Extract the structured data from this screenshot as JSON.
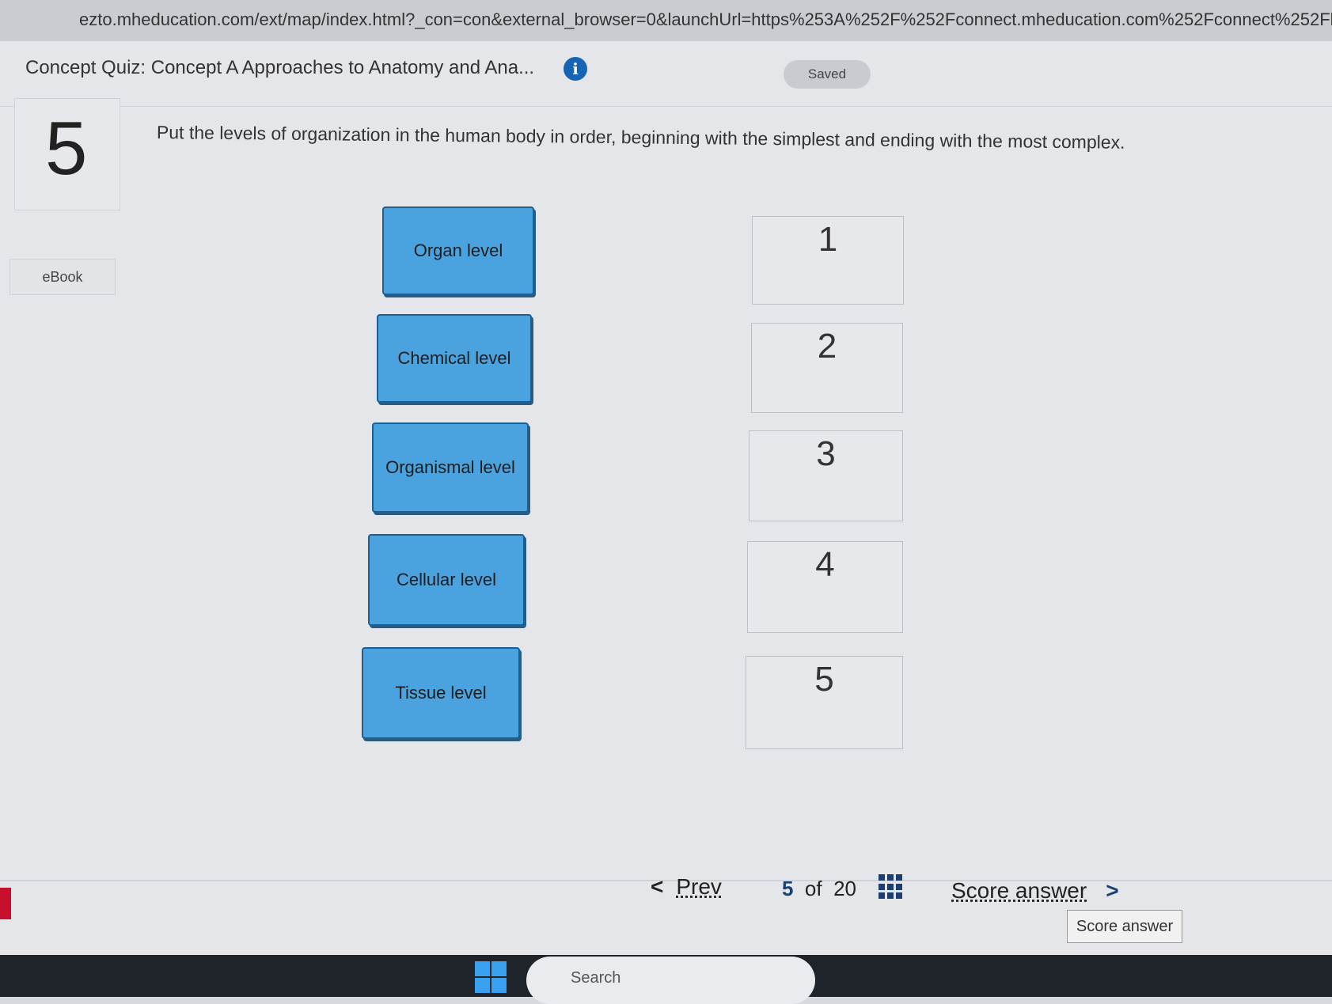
{
  "browser": {
    "url": "ezto.mheducation.com/ext/map/index.html?_con=con&external_browser=0&launchUrl=https%253A%252F%252Fconnect.mheducation.com%252Fconnect%252Fl"
  },
  "header": {
    "quiz_title": "Concept Quiz: Concept A Approaches to Anatomy and Ana...",
    "save_status": "Saved"
  },
  "question": {
    "number": "5",
    "prompt": "Put the levels of organization in the human body in order, beginning with the simplest and ending with the most complex."
  },
  "sidebar": {
    "ebook_label": "eBook"
  },
  "drag_items": [
    {
      "label": "Organ level"
    },
    {
      "label": "Chemical level"
    },
    {
      "label": "Organismal level"
    },
    {
      "label": "Cellular level"
    },
    {
      "label": "Tissue level"
    }
  ],
  "drop_slots": [
    {
      "label": "1"
    },
    {
      "label": "2"
    },
    {
      "label": "3"
    },
    {
      "label": "4"
    },
    {
      "label": "5"
    }
  ],
  "footer": {
    "prev_label": "Prev",
    "current_page": "5",
    "of_label": "of",
    "total_pages": "20",
    "score_label": "Score answer",
    "tooltip": "Score answer"
  },
  "taskbar": {
    "search_placeholder": "Search"
  },
  "colors": {
    "item_fill": "#4aa3df",
    "item_border": "#1b5f93",
    "accent_navy": "#1a3f75",
    "info_blue": "#1565b7"
  }
}
